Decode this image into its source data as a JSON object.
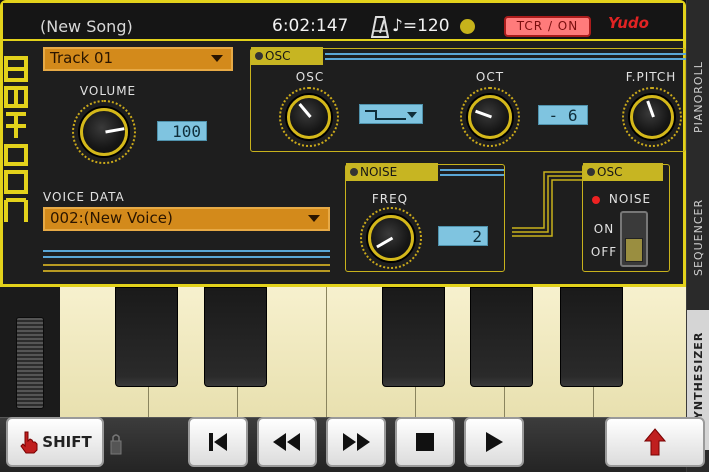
{
  "header": {
    "song_title": "(New Song)",
    "time": "6:02:147",
    "tempo": "♪=120",
    "tcr_button": "TCR / ON",
    "brand": "Yudo"
  },
  "app_logo_text": "8bitone",
  "track": {
    "selected": "Track 01"
  },
  "volume": {
    "label": "VOLUME",
    "value": "100"
  },
  "voice_data": {
    "label": "VOICE DATA",
    "selected": "002:(New Voice)"
  },
  "osc_section": {
    "tab": "OSC",
    "osc_label": "OSC",
    "oct_label": "OCT",
    "oct_value": "- 6",
    "fpitch_label": "F.PITCH"
  },
  "noise_section": {
    "tab": "NOISE",
    "freq_label": "FREQ",
    "freq_value": "2"
  },
  "osc_noise": {
    "tab": "OSC",
    "noise_label": "NOISE",
    "on_label": "ON",
    "off_label": "OFF"
  },
  "side_tabs": [
    {
      "label": "PIANOROLL"
    },
    {
      "label": "SEQUENCER"
    },
    {
      "label": "SYNTHESIZER"
    }
  ],
  "transport": {
    "shift_label": "SHIFT"
  },
  "colors": {
    "accent_yellow": "#e3d21b",
    "dropdown_orange": "#d38a1b",
    "lcd_blue": "#7fc4e0",
    "tcr_red": "#ff7b7b"
  }
}
